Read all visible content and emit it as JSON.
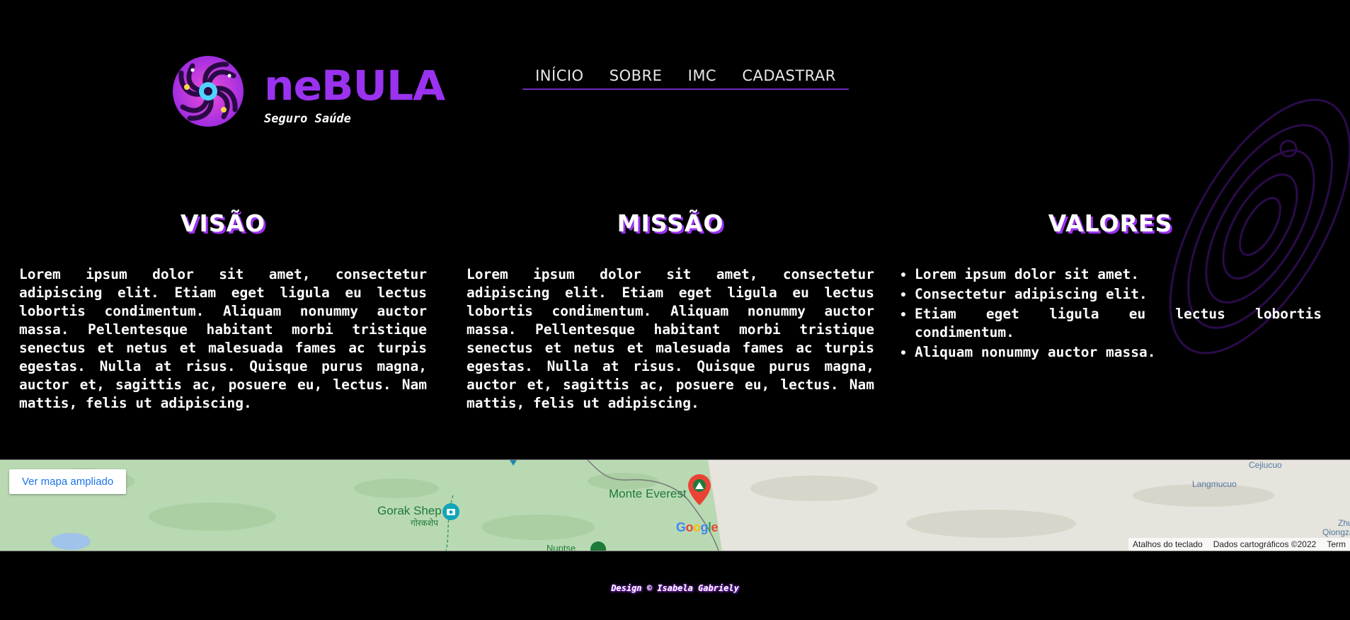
{
  "brand": {
    "name": "neBULA",
    "tagline": "Seguro Saúde"
  },
  "nav": {
    "items": [
      "INÍCIO",
      "SOBRE",
      "IMC",
      "CADASTRAR"
    ]
  },
  "sections": {
    "visao": {
      "title": "VISÃO",
      "text": "Lorem ipsum dolor sit amet, consectetur adipiscing elit. Etiam eget ligula eu lectus lobortis condimentum. Aliquam nonummy auctor massa. Pellentesque habitant morbi tristique senectus et netus et malesuada fames ac turpis egestas. Nulla at risus. Quisque purus magna, auctor et, sagittis ac, posuere eu, lectus. Nam mattis, felis ut adipiscing."
    },
    "missao": {
      "title": "MISSÃO",
      "text": "Lorem ipsum dolor sit amet, consectetur adipiscing elit. Etiam eget ligula eu lectus lobortis condimentum. Aliquam nonummy auctor massa. Pellentesque habitant morbi tristique senectus et netus et malesuada fames ac turpis egestas. Nulla at risus. Quisque purus magna, auctor et, sagittis ac, posuere eu, lectus. Nam mattis, felis ut adipiscing."
    },
    "valores": {
      "title": "VALORES",
      "items": [
        "Lorem ipsum dolor sit amet.",
        "Consectetur adipiscing elit.",
        "Etiam eget ligula eu lectus lobortis condimentum.",
        "Aliquam nonummy auctor massa."
      ]
    }
  },
  "map": {
    "button_label": "Ver mapa ampliado",
    "places": {
      "everest": "Monte Everest",
      "gorak": "Gorak Shep",
      "gorak_local": "गोरकशेप",
      "nuptse": "Nuptse",
      "langmucuo": "Langmucuo",
      "cejiucuo": "Cejiucuo",
      "zhu": "Zhu",
      "qiongza": "Qiongza"
    },
    "footer": {
      "shortcuts": "Atalhos do teclado",
      "data": "Dados cartográficos ©2022",
      "terms": "Term"
    },
    "google_letters": [
      "G",
      "o",
      "o",
      "g",
      "l",
      "e"
    ],
    "google_colors": [
      "#4285f4",
      "#ea4335",
      "#fbbc05",
      "#4285f4",
      "#34a853",
      "#ea4335"
    ]
  },
  "footer": {
    "credit": "Design © Isabela Gabriely"
  },
  "colors": {
    "accent": "#9a32f0",
    "nav_underline": "#6f2ab3",
    "background": "#000000"
  }
}
